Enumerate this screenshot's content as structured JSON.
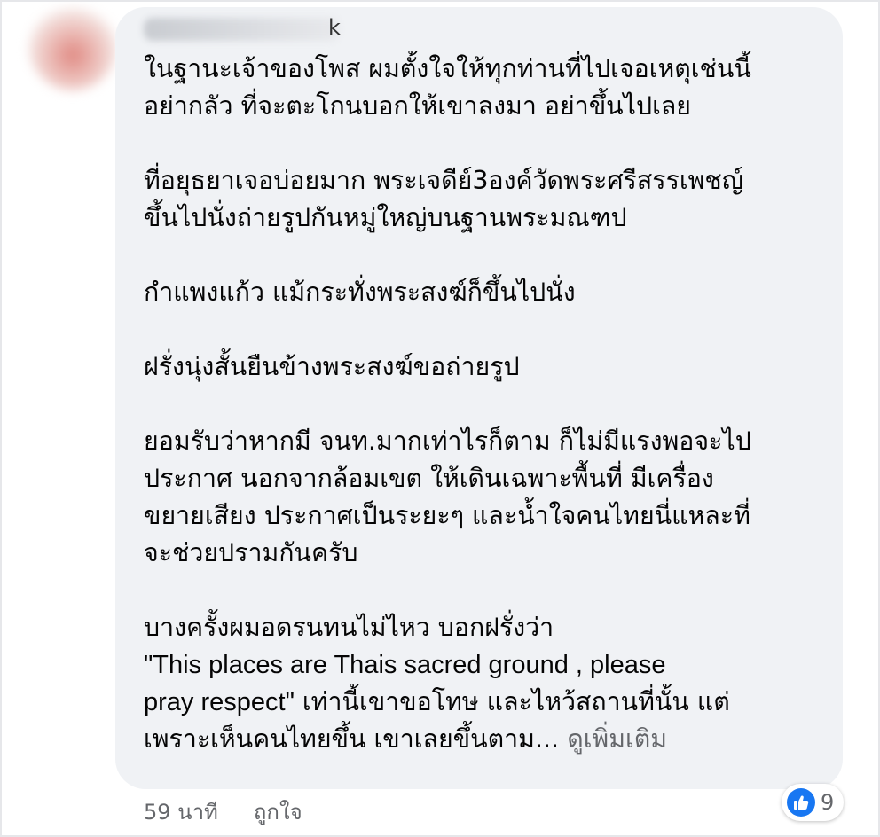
{
  "comment": {
    "author_visible_suffix": "k",
    "paragraphs": [
      [
        "ในฐานะเจ้าของโพส ผมตั้งใจให้ทุกท่านที่ไปเจอเหตุเช่นนี้",
        "อย่ากลัว ที่จะตะโกนบอกให้เขาลงมา อย่าขึ้นไปเลย"
      ],
      [
        "ที่อยุธยาเจอบ่อยมาก พระเจดีย์3องค์วัดพระศรีสรรเพชญ์",
        "ขึ้นไปนั่งถ่ายรูปกันหมู่ใหญ่บนฐานพระมณฑป"
      ],
      [
        "กำแพงแก้ว แม้กระทั่งพระสงฆ์ก็ขึ้นไปนั่ง"
      ],
      [
        "ฝรั่งนุ่งสั้นยืนข้างพระสงฆ์ขอถ่ายรูป"
      ],
      [
        "ยอมรับว่าหากมี จนท.มากเท่าไรก็ตาม ก็ไม่มีแรงพอจะไป",
        "ประกาศ นอกจากล้อมเขต ให้เดินเฉพาะพื้นที่ มีเครื่อง",
        "ขยายเสียง ประกาศเป็นระยะๆ และน้ำใจคนไทยนี่แหละที่",
        "จะช่วยปรามกันครับ"
      ]
    ],
    "last_paragraph": {
      "line1": "บางครั้งผมอดรนทนไม่ไหว บอกฝรั่งว่า",
      "line2": "\"This places are Thais sacred ground , please",
      "line3_en": "pray respect\"",
      "line3_th": " เท่านี้เขาขอโทษ และไหว้สถานที่นั้น แต่",
      "line4": "เพราะเห็นคนไทยขึ้น เขาเลยขึ้นตาม...",
      "see_more": "ดูเพิ่มเติม"
    }
  },
  "reactions": {
    "icon": "like-icon",
    "count": "9",
    "color": "#1877f2"
  },
  "footer": {
    "time": "59 นาที",
    "like_label": "ถูกใจ"
  }
}
